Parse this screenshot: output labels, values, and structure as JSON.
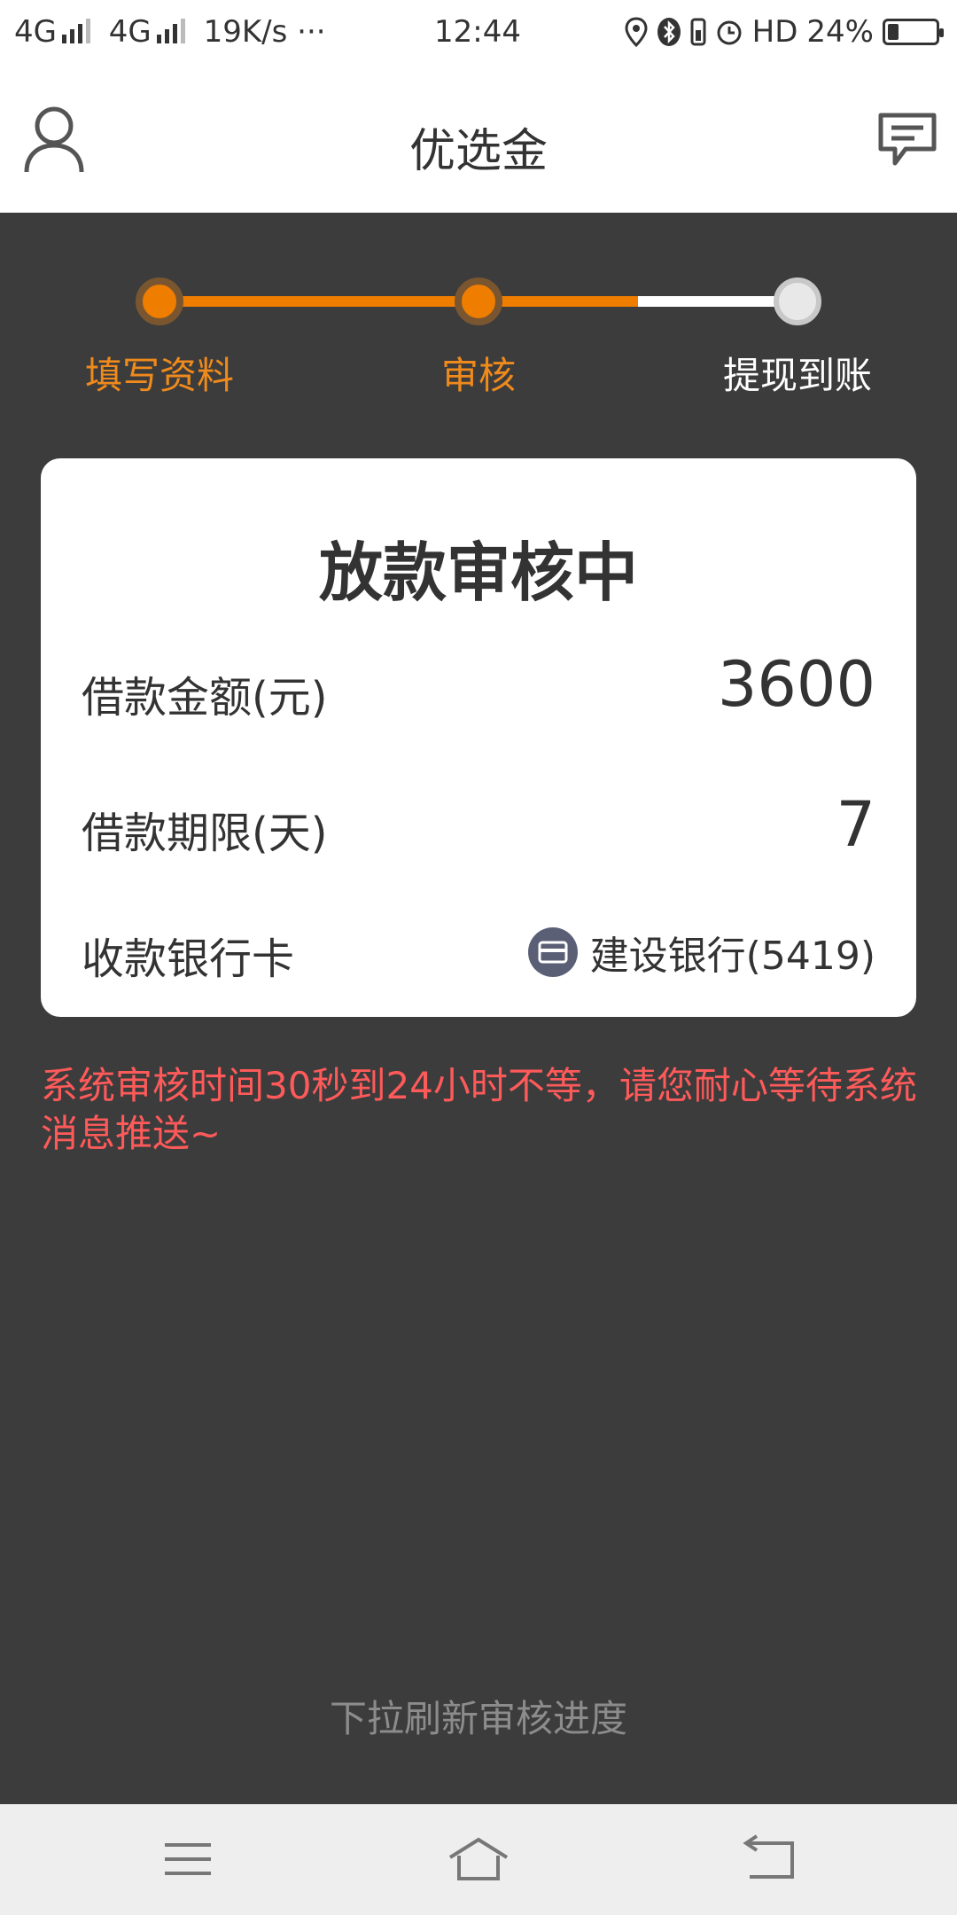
{
  "status_bar": {
    "net1": "4G",
    "net2": "4G",
    "speed": "19K/s",
    "more": "···",
    "time": "12:44",
    "hd": "HD",
    "battery_label": "24%",
    "battery_level_percent": 24
  },
  "header": {
    "title": "优选金",
    "user_icon": "user-icon",
    "message_icon": "message-icon"
  },
  "steps": [
    {
      "label": "填写资料",
      "state": "done"
    },
    {
      "label": "审核",
      "state": "active"
    },
    {
      "label": "提现到账",
      "state": "pending"
    }
  ],
  "colors": {
    "accent": "#ef7d00",
    "background": "#3c3c3d",
    "notice": "#ff5a5a",
    "card": "#ffffff"
  },
  "card": {
    "title": "放款审核中",
    "amount_label": "借款金额(元)",
    "amount_value": "3600",
    "term_label": "借款期限(天)",
    "term_value": "7",
    "bank_label": "收款银行卡",
    "bank_value": "建设银行(5419)",
    "bank_icon": "bank-card-icon"
  },
  "notice": "系统审核时间30秒到24小时不等，请您耐心等待系统消息推送~",
  "refresh_tip": "下拉刷新审核进度",
  "nav": {
    "menu_icon": "menu-icon",
    "home_icon": "home-icon",
    "back_icon": "back-icon"
  }
}
